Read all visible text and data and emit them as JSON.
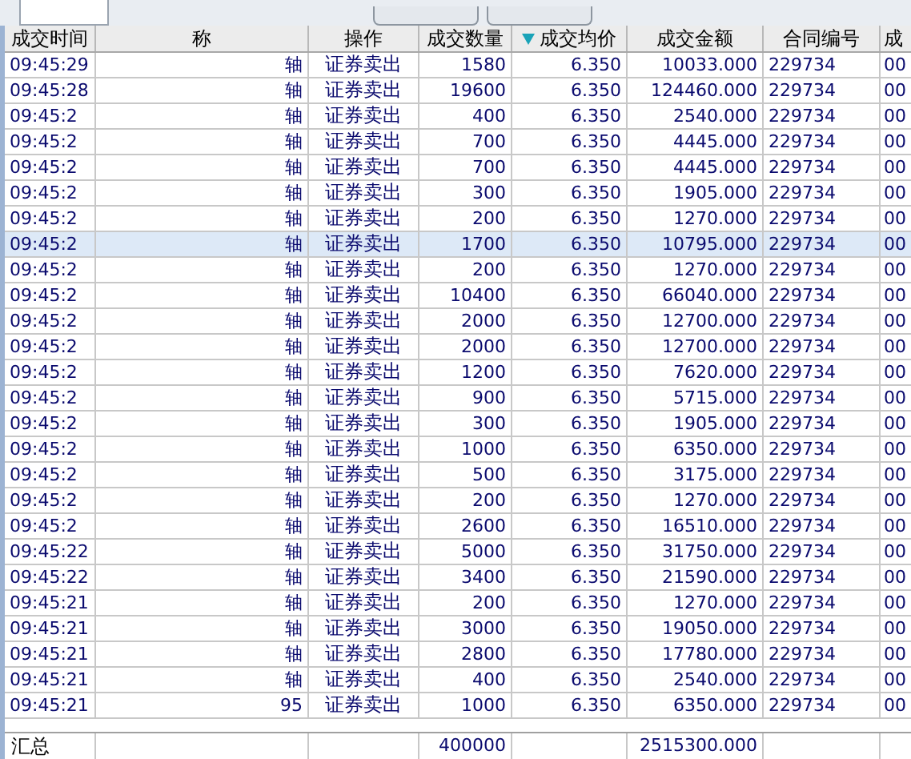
{
  "columns": [
    {
      "label": "成交时间",
      "sorted": false
    },
    {
      "label": "称",
      "sorted": false
    },
    {
      "label": "操作",
      "sorted": false
    },
    {
      "label": "成交数量",
      "sorted": false
    },
    {
      "label": "成交均价",
      "sorted": true
    },
    {
      "label": "成交金额",
      "sorted": false
    },
    {
      "label": "合同编号",
      "sorted": false
    },
    {
      "label": "成",
      "sorted": false
    }
  ],
  "rows": [
    {
      "time": "09:45:29",
      "name": "轴",
      "op": "证券卖出",
      "qty": "1580",
      "price": "6.350",
      "amount": "10033.000",
      "contract": "229734",
      "col8": "00",
      "selected": false
    },
    {
      "time": "09:45:28",
      "name": "轴",
      "op": "证券卖出",
      "qty": "19600",
      "price": "6.350",
      "amount": "124460.000",
      "contract": "229734",
      "col8": "00",
      "selected": false
    },
    {
      "time": "09:45:2",
      "name": "轴",
      "op": "证券卖出",
      "qty": "400",
      "price": "6.350",
      "amount": "2540.000",
      "contract": "229734",
      "col8": "00",
      "selected": false
    },
    {
      "time": "09:45:2",
      "name": "轴",
      "op": "证券卖出",
      "qty": "700",
      "price": "6.350",
      "amount": "4445.000",
      "contract": "229734",
      "col8": "00",
      "selected": false
    },
    {
      "time": "09:45:2",
      "name": "轴",
      "op": "证券卖出",
      "qty": "700",
      "price": "6.350",
      "amount": "4445.000",
      "contract": "229734",
      "col8": "00",
      "selected": false
    },
    {
      "time": "09:45:2",
      "name": "轴",
      "op": "证券卖出",
      "qty": "300",
      "price": "6.350",
      "amount": "1905.000",
      "contract": "229734",
      "col8": "00",
      "selected": false
    },
    {
      "time": "09:45:2",
      "name": "轴",
      "op": "证券卖出",
      "qty": "200",
      "price": "6.350",
      "amount": "1270.000",
      "contract": "229734",
      "col8": "00",
      "selected": false
    },
    {
      "time": "09:45:2",
      "name": "轴",
      "op": "证券卖出",
      "qty": "1700",
      "price": "6.350",
      "amount": "10795.000",
      "contract": "229734",
      "col8": "00",
      "selected": true
    },
    {
      "time": "09:45:2",
      "name": "轴",
      "op": "证券卖出",
      "qty": "200",
      "price": "6.350",
      "amount": "1270.000",
      "contract": "229734",
      "col8": "00",
      "selected": false
    },
    {
      "time": "09:45:2",
      "name": "轴",
      "op": "证券卖出",
      "qty": "10400",
      "price": "6.350",
      "amount": "66040.000",
      "contract": "229734",
      "col8": "00",
      "selected": false
    },
    {
      "time": "09:45:2",
      "name": "轴",
      "op": "证券卖出",
      "qty": "2000",
      "price": "6.350",
      "amount": "12700.000",
      "contract": "229734",
      "col8": "00",
      "selected": false
    },
    {
      "time": "09:45:2",
      "name": "轴",
      "op": "证券卖出",
      "qty": "2000",
      "price": "6.350",
      "amount": "12700.000",
      "contract": "229734",
      "col8": "00",
      "selected": false
    },
    {
      "time": "09:45:2",
      "name": "轴",
      "op": "证券卖出",
      "qty": "1200",
      "price": "6.350",
      "amount": "7620.000",
      "contract": "229734",
      "col8": "00",
      "selected": false
    },
    {
      "time": "09:45:2",
      "name": "轴",
      "op": "证券卖出",
      "qty": "900",
      "price": "6.350",
      "amount": "5715.000",
      "contract": "229734",
      "col8": "00",
      "selected": false
    },
    {
      "time": "09:45:2",
      "name": "轴",
      "op": "证券卖出",
      "qty": "300",
      "price": "6.350",
      "amount": "1905.000",
      "contract": "229734",
      "col8": "00",
      "selected": false
    },
    {
      "time": "09:45:2",
      "name": "轴",
      "op": "证券卖出",
      "qty": "1000",
      "price": "6.350",
      "amount": "6350.000",
      "contract": "229734",
      "col8": "00",
      "selected": false
    },
    {
      "time": "09:45:2",
      "name": "轴",
      "op": "证券卖出",
      "qty": "500",
      "price": "6.350",
      "amount": "3175.000",
      "contract": "229734",
      "col8": "00",
      "selected": false
    },
    {
      "time": "09:45:2",
      "name": "轴",
      "op": "证券卖出",
      "qty": "200",
      "price": "6.350",
      "amount": "1270.000",
      "contract": "229734",
      "col8": "00",
      "selected": false
    },
    {
      "time": "09:45:2",
      "name": "轴",
      "op": "证券卖出",
      "qty": "2600",
      "price": "6.350",
      "amount": "16510.000",
      "contract": "229734",
      "col8": "00",
      "selected": false
    },
    {
      "time": "09:45:22",
      "name": "轴",
      "op": "证券卖出",
      "qty": "5000",
      "price": "6.350",
      "amount": "31750.000",
      "contract": "229734",
      "col8": "00",
      "selected": false
    },
    {
      "time": "09:45:22",
      "name": "轴",
      "op": "证券卖出",
      "qty": "3400",
      "price": "6.350",
      "amount": "21590.000",
      "contract": "229734",
      "col8": "00",
      "selected": false
    },
    {
      "time": "09:45:21",
      "name": "轴",
      "op": "证券卖出",
      "qty": "200",
      "price": "6.350",
      "amount": "1270.000",
      "contract": "229734",
      "col8": "00",
      "selected": false
    },
    {
      "time": "09:45:21",
      "name": "轴",
      "op": "证券卖出",
      "qty": "3000",
      "price": "6.350",
      "amount": "19050.000",
      "contract": "229734",
      "col8": "00",
      "selected": false
    },
    {
      "time": "09:45:21",
      "name": "轴",
      "op": "证券卖出",
      "qty": "2800",
      "price": "6.350",
      "amount": "17780.000",
      "contract": "229734",
      "col8": "00",
      "selected": false
    },
    {
      "time": "09:45:21",
      "name": "轴",
      "op": "证券卖出",
      "qty": "400",
      "price": "6.350",
      "amount": "2540.000",
      "contract": "229734",
      "col8": "00",
      "selected": false
    },
    {
      "time": "09:45:21",
      "name": "95",
      "op": "证券卖出",
      "qty": "1000",
      "price": "6.350",
      "amount": "6350.000",
      "contract": "229734",
      "col8": "00",
      "selected": false
    }
  ],
  "summary": {
    "label": "汇总",
    "qty": "400000",
    "amount": "2515300.000"
  }
}
